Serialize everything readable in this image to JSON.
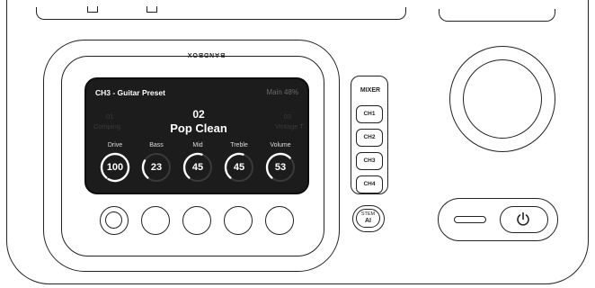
{
  "device": {
    "brand_logo": "BANDBOX"
  },
  "screen": {
    "title": "CH3 - Guitar Preset",
    "main_level": "Main 48%",
    "prev_preset": {
      "number": "01",
      "name": "Comping"
    },
    "current_preset": {
      "number": "02",
      "name": "Pop Clean"
    },
    "next_preset": {
      "number": "03",
      "name": "Vintage T"
    },
    "knobs": [
      {
        "label": "Drive",
        "value": "100",
        "level": 1.0
      },
      {
        "label": "Bass",
        "value": "23",
        "level": 0.23
      },
      {
        "label": "Mid",
        "value": "45",
        "level": 0.45
      },
      {
        "label": "Treble",
        "value": "45",
        "level": 0.45
      },
      {
        "label": "Volume",
        "value": "53",
        "level": 0.53
      }
    ]
  },
  "mixer": {
    "label": "MIXER",
    "channels": [
      "CH1",
      "CH2",
      "CH3",
      "CH4"
    ]
  },
  "stem": {
    "line1": "STEM",
    "line2": "AI"
  },
  "power": {
    "icon": "power-icon"
  },
  "colors": {
    "screen_bg": "#1c1c1c",
    "outline": "#222222",
    "arc": "#ffffff",
    "dim_text": "#3a3a3a"
  }
}
